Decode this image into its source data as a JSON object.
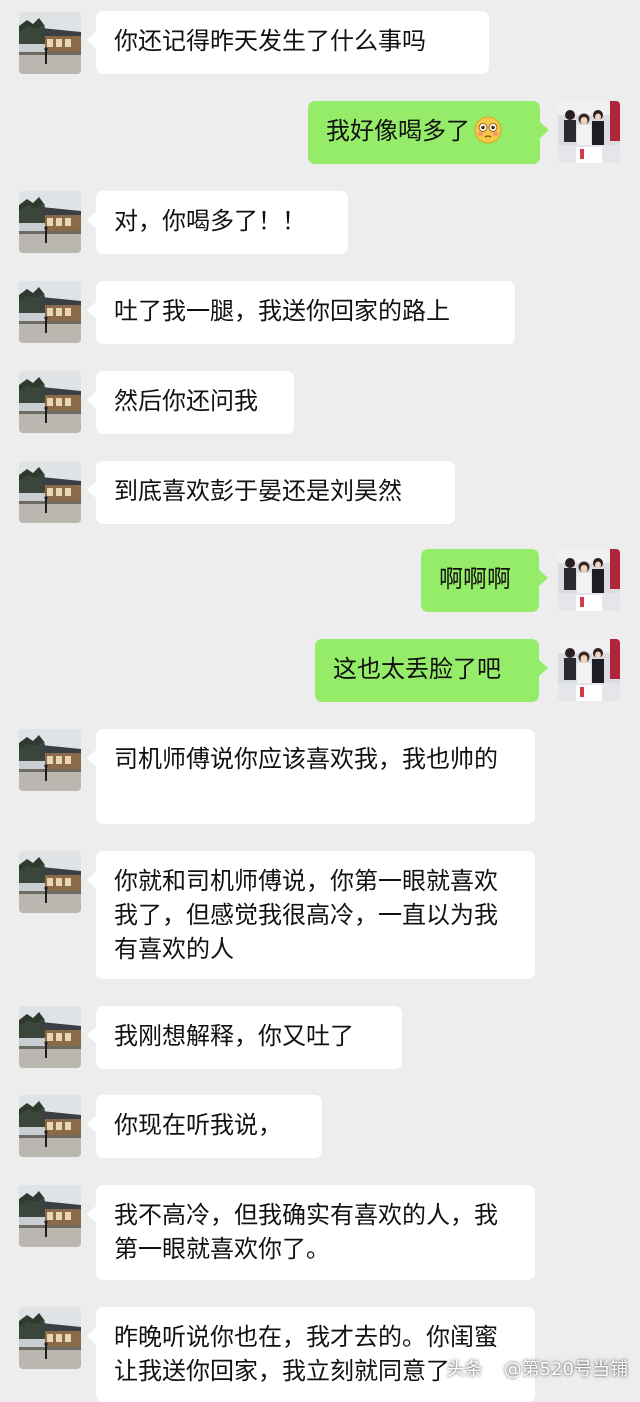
{
  "chat": {
    "messages": [
      {
        "side": "left",
        "text": "你还记得昨天发生了什么事吗"
      },
      {
        "side": "right",
        "text": "我好像喝多了",
        "emoji": "flushed-face"
      },
      {
        "side": "left",
        "text": "对，你喝多了！！"
      },
      {
        "side": "left",
        "text": "吐了我一腿，我送你回家的路上"
      },
      {
        "side": "left",
        "text": "然后你还问我"
      },
      {
        "side": "left",
        "text": "到底喜欢彭于晏还是刘昊然"
      },
      {
        "side": "right",
        "text": "啊啊啊"
      },
      {
        "side": "right",
        "text": "这也太丢脸了吧"
      },
      {
        "side": "left",
        "text": "司机师傅说你应该喜欢我，我也帅的"
      },
      {
        "side": "left",
        "text": "你就和司机师傅说，你第一眼就喜欢我了，但感觉我很高冷，一直以为我有喜欢的人"
      },
      {
        "side": "left",
        "text": "我刚想解释，你又吐了"
      },
      {
        "side": "left",
        "text": "你现在听我说，"
      },
      {
        "side": "left",
        "text": "我不高冷，但我确实有喜欢的人，我第一眼就喜欢你了。"
      },
      {
        "side": "left",
        "text": "昨晚听说你也在，我才去的。你闺蜜让我送你回家，我立刻就同意了"
      }
    ]
  },
  "watermark": {
    "prefix": "头条",
    "text": "@第520号当铺"
  },
  "colors": {
    "background": "#ededed",
    "incoming_bubble": "#ffffff",
    "outgoing_bubble": "#95ec69"
  },
  "icons": {
    "left_avatar": "house-landscape-avatar-icon",
    "right_avatar": "group-photo-avatar-icon",
    "emoji": "flushed-face-icon"
  }
}
